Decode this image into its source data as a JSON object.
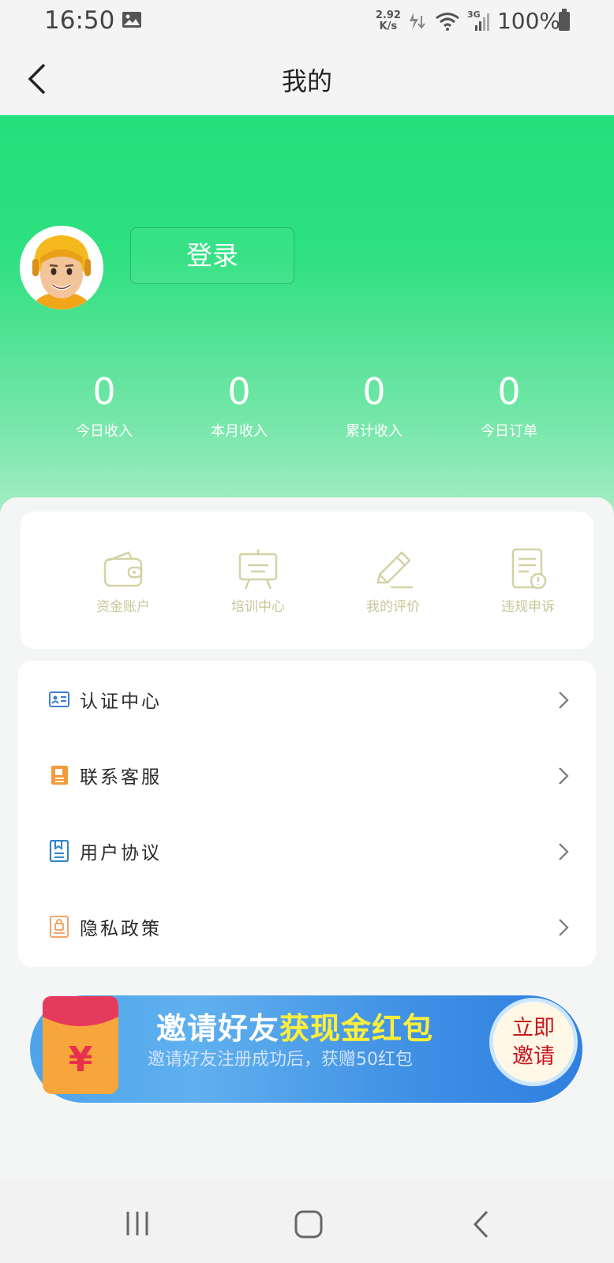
{
  "status_bar": {
    "time": "16:50",
    "net_speed_value": "2.92",
    "net_speed_unit": "K/s",
    "signal_type": "3G",
    "battery": "100%"
  },
  "nav": {
    "title": "我的",
    "back_icon": "chevron-left-icon"
  },
  "profile": {
    "login_label": "登录",
    "stats": [
      {
        "value": "0",
        "label": "今日收入"
      },
      {
        "value": "0",
        "label": "本月收入"
      },
      {
        "value": "0",
        "label": "累计收入"
      },
      {
        "value": "0",
        "label": "今日订单"
      }
    ]
  },
  "quick_actions": [
    {
      "label": "资金账户",
      "icon": "wallet-icon"
    },
    {
      "label": "培训中心",
      "icon": "easel-icon"
    },
    {
      "label": "我的评价",
      "icon": "pencil-icon"
    },
    {
      "label": "违规申诉",
      "icon": "document-alert-icon"
    }
  ],
  "menu": [
    {
      "label": "认证中心",
      "icon": "id-card-icon",
      "color": "#3a7dd6"
    },
    {
      "label": "联系客服",
      "icon": "contact-book-icon",
      "color": "#f39a3b"
    },
    {
      "label": "用户协议",
      "icon": "agreement-icon",
      "color": "#2f86c6"
    },
    {
      "label": "隐私政策",
      "icon": "privacy-lock-icon",
      "color": "#f0a66a"
    }
  ],
  "banner": {
    "title_main": "邀请好友",
    "title_highlight": "获现金红包",
    "subtitle": "邀请好友注册成功后，获赠50红包",
    "cta_line1": "立即",
    "cta_line2": "邀请",
    "redpack_symbol": "¥"
  },
  "colors": {
    "brand_green": "#23e07b",
    "quick_label": "#c8c79a",
    "highlight_yellow": "#ffef3a",
    "cta_red": "#c8161e"
  }
}
